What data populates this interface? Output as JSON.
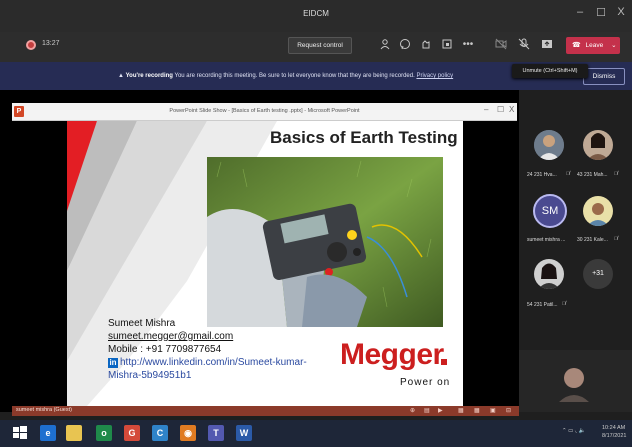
{
  "window": {
    "title": "EIDCM",
    "controls": [
      "–",
      "☐",
      "X"
    ]
  },
  "meeting": {
    "timer": "13:27",
    "request_control": "Request control",
    "leave": "Leave",
    "toolbar_icons": [
      "people-icon",
      "chat-icon",
      "reactions-icon",
      "rooms-icon",
      "more-icon",
      "camera-off-icon",
      "mic-off-icon",
      "share-icon"
    ]
  },
  "banner": {
    "bold": "You're recording",
    "text": "You are recording this meeting. Be sure to let everyone know that they are being recorded.",
    "link": "Privacy policy",
    "dismiss": "Dismiss"
  },
  "tooltip": "Unmute (Ctrl+Shift+M)",
  "ppt": {
    "logo": "P",
    "title": "PowerPoint Slide Show - [Basics of Earth testing .pptx] - Microsoft PowerPoint",
    "controls": [
      "–",
      "☐",
      "X"
    ]
  },
  "slide": {
    "title": "Basics of Earth Testing",
    "name": "Sumeet Mishra",
    "email": "sumeet.megger@gmail.com",
    "mobile": "Mobile : +91 7709877654",
    "li_badge": "in",
    "linkedin_line1": "http://www.linkedin.com/in/Sumeet-kumar-",
    "linkedin_line2": "Mishra-5b94951b1",
    "brand": "Megger",
    "tagline": "Power on"
  },
  "presenter": {
    "label": "sumeet mishra (Guest)"
  },
  "participants": [
    {
      "name": "24 231 Hva...",
      "kind": "photo"
    },
    {
      "name": "43 231 Mah...",
      "kind": "photo"
    },
    {
      "name": "sumeet mishra ...",
      "kind": "initials",
      "initials": "SM"
    },
    {
      "name": "30 231 Kale...",
      "kind": "photo"
    },
    {
      "name": "54 231 Patil...",
      "kind": "photo"
    }
  ],
  "more_participants": "+31",
  "taskbar": {
    "apps": [
      "start-icon",
      "edge-icon",
      "explorer-icon",
      "word-app-icon",
      "chrome-icon",
      "store-icon",
      "firefox-icon",
      "teams-icon",
      "word-icon"
    ],
    "time": "10:24 AM",
    "date": "8/17/2021"
  },
  "colors": {
    "leave": "#c4314b",
    "banner": "#262c54",
    "presenter_bar": "#8b3a2a",
    "megger_red": "#cc1f1f"
  }
}
